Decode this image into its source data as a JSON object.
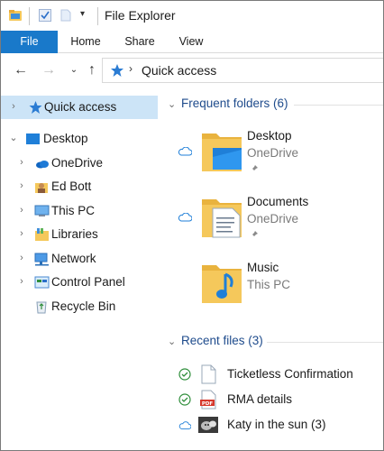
{
  "window": {
    "title": "File Explorer"
  },
  "ribbon": {
    "tabs": [
      {
        "label": "File"
      },
      {
        "label": "Home"
      },
      {
        "label": "Share"
      },
      {
        "label": "View"
      }
    ]
  },
  "address": {
    "path": "Quick access"
  },
  "nav": {
    "items": [
      {
        "label": "Quick access",
        "icon": "quick-access-star-icon",
        "selected": true
      },
      {
        "label": "Desktop",
        "icon": "desktop-icon",
        "expanded": true
      },
      {
        "label": "OneDrive",
        "icon": "onedrive-icon"
      },
      {
        "label": "Ed Bott",
        "icon": "user-folder-icon"
      },
      {
        "label": "This PC",
        "icon": "this-pc-icon"
      },
      {
        "label": "Libraries",
        "icon": "libraries-icon"
      },
      {
        "label": "Network",
        "icon": "network-icon"
      },
      {
        "label": "Control Panel",
        "icon": "control-panel-icon"
      },
      {
        "label": "Recycle Bin",
        "icon": "recycle-bin-icon"
      }
    ]
  },
  "frequent": {
    "title": "Frequent folders (6)",
    "folders": [
      {
        "name": "Desktop",
        "location": "OneDrive",
        "pinned": true,
        "status": "cloud"
      },
      {
        "name": "Documents",
        "location": "OneDrive",
        "pinned": true,
        "status": "cloud"
      },
      {
        "name": "Music",
        "location": "This PC",
        "pinned": false,
        "status": "none"
      }
    ]
  },
  "recent": {
    "title": "Recent files (3)",
    "files": [
      {
        "name": "Ticketless Confirmation",
        "status": "synced",
        "type": "document"
      },
      {
        "name": "RMA details",
        "status": "synced",
        "type": "pdf",
        "badge": "PDF"
      },
      {
        "name": "Katy in the sun (3)",
        "status": "cloud",
        "type": "image"
      }
    ]
  },
  "colors": {
    "accent": "#1979ca",
    "selection": "#cce4f7",
    "group_title": "#1e4b8c",
    "folder": "#f5c85b"
  }
}
